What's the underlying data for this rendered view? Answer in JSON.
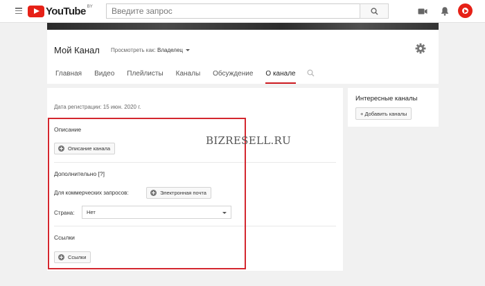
{
  "masthead": {
    "logo_text": "YouTube",
    "region": "BY",
    "search_placeholder": "Введите запрос"
  },
  "icons": {
    "menu": "hamburger-icon",
    "search": "search-icon",
    "upload": "video-camera-icon",
    "notifications": "bell-icon",
    "settings": "gear-icon"
  },
  "colors": {
    "brand_red": "#e62117",
    "tab_underline": "#cc181e",
    "highlight_box": "#d3262e"
  },
  "channel": {
    "title": "Мой Канал",
    "view_as_label": "Просмотреть как:",
    "view_as_value": "Владелец",
    "tabs": [
      {
        "label": "Главная"
      },
      {
        "label": "Видео"
      },
      {
        "label": "Плейлисты"
      },
      {
        "label": "Каналы"
      },
      {
        "label": "Обсуждение"
      },
      {
        "label": "О канале",
        "active": true
      }
    ]
  },
  "about": {
    "joined": "Дата регистрации: 15 июн. 2020 г.",
    "description_title": "Описание",
    "description_button": "Описание канала",
    "additional_title": "Дополнительно [?]",
    "business_label": "Для коммерческих запросов:",
    "email_button": "Электронная почта",
    "country_label": "Страна:",
    "country_value": "Нет",
    "links_title": "Ссылки",
    "links_button": "Ссылки"
  },
  "sidebar": {
    "title": "Интересные каналы",
    "add_button": "+ Добавить каналы"
  },
  "watermark": "BIZRESELL.RU"
}
